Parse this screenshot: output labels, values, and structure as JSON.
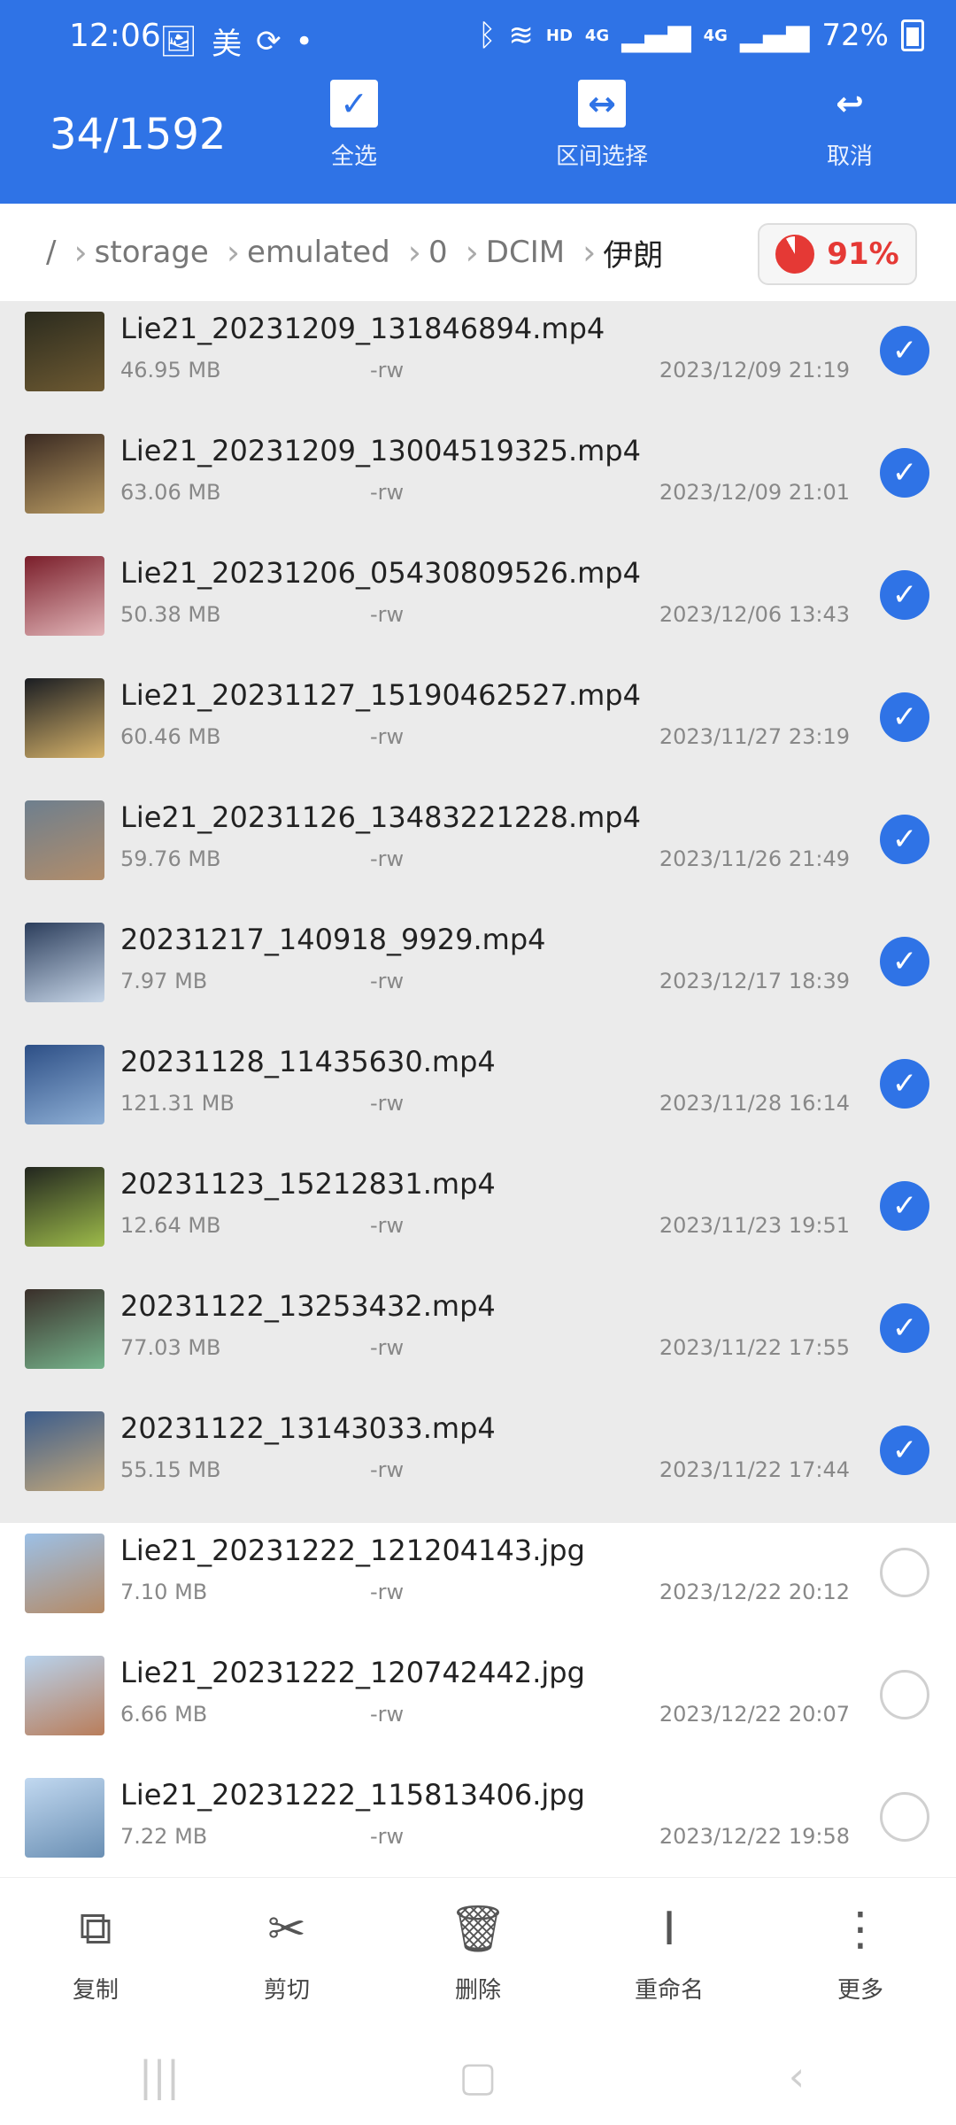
{
  "status": {
    "time": "12:06",
    "left_icons": [
      "image-icon",
      "美",
      "sync-icon",
      "dot-icon"
    ],
    "right_icons": [
      "bluetooth-icon",
      "wifi-icon",
      "signal-icon",
      "signal-icon"
    ],
    "hd": "HD",
    "net1": "4G",
    "net2": "4G",
    "battery": "72%"
  },
  "header": {
    "count": "34/1592",
    "actions": [
      {
        "label": "全选",
        "icon": "checkbox-icon",
        "glyph": "✓"
      },
      {
        "label": "区间选择",
        "icon": "range-select-icon",
        "glyph": "↔"
      },
      {
        "label": "取消",
        "icon": "undo-icon",
        "glyph": "↩"
      }
    ]
  },
  "breadcrumb": {
    "root": "/",
    "items": [
      "storage",
      "emulated",
      "0",
      "DCIM",
      "伊朗"
    ],
    "storage_percent": "91%"
  },
  "files": [
    {
      "name": "Lie21_20231209_131846894.mp4",
      "size": "46.95 MB",
      "perm": "-rw",
      "date": "2023/12/09 21:19",
      "selected": true,
      "thumb": [
        "#2b2b1e",
        "#6e5a32"
      ]
    },
    {
      "name": "Lie21_20231209_13004519325.mp4",
      "size": "63.06 MB",
      "perm": "-rw",
      "date": "2023/12/09 21:01",
      "selected": true,
      "thumb": [
        "#3a2a22",
        "#b89a62"
      ]
    },
    {
      "name": "Lie21_20231206_05430809526.mp4",
      "size": "50.38 MB",
      "perm": "-rw",
      "date": "2023/12/06 13:43",
      "selected": true,
      "thumb": [
        "#7a1e2a",
        "#e2b6b9"
      ]
    },
    {
      "name": "Lie21_20231127_15190462527.mp4",
      "size": "60.46 MB",
      "perm": "-rw",
      "date": "2023/11/27 23:19",
      "selected": true,
      "thumb": [
        "#1a1d22",
        "#d7b36a"
      ]
    },
    {
      "name": "Lie21_20231126_13483221228.mp4",
      "size": "59.76 MB",
      "perm": "-rw",
      "date": "2023/11/26 21:49",
      "selected": true,
      "thumb": [
        "#6e7f8e",
        "#b28d6a"
      ]
    },
    {
      "name": "20231217_140918_9929.mp4",
      "size": "7.97 MB",
      "perm": "-rw",
      "date": "2023/12/17 18:39",
      "selected": true,
      "thumb": [
        "#2c3e5c",
        "#c7d6e8"
      ]
    },
    {
      "name": "20231128_11435630.mp4",
      "size": "121.31 MB",
      "perm": "-rw",
      "date": "2023/11/28 16:14",
      "selected": true,
      "thumb": [
        "#2d4f86",
        "#8fb0d6"
      ]
    },
    {
      "name": "20231123_15212831.mp4",
      "size": "12.64 MB",
      "perm": "-rw",
      "date": "2023/11/23 19:51",
      "selected": true,
      "thumb": [
        "#22261f",
        "#9dbb4a"
      ]
    },
    {
      "name": "20231122_13253432.mp4",
      "size": "77.03 MB",
      "perm": "-rw",
      "date": "2023/11/22 17:55",
      "selected": true,
      "thumb": [
        "#3a2f2a",
        "#76b48c"
      ]
    },
    {
      "name": "20231122_13143033.mp4",
      "size": "55.15 MB",
      "perm": "-rw",
      "date": "2023/11/22 17:44",
      "selected": true,
      "thumb": [
        "#3c5d8c",
        "#c2a77a"
      ]
    },
    {
      "name": "Lie21_20231222_121204143.jpg",
      "size": "7.10 MB",
      "perm": "-rw",
      "date": "2023/12/22 20:12",
      "selected": false,
      "thumb": [
        "#9cc0e6",
        "#b58a65"
      ]
    },
    {
      "name": "Lie21_20231222_120742442.jpg",
      "size": "6.66 MB",
      "perm": "-rw",
      "date": "2023/12/22 20:07",
      "selected": false,
      "thumb": [
        "#b8d2ec",
        "#b97d5a"
      ]
    },
    {
      "name": "Lie21_20231222_115813406.jpg",
      "size": "7.22 MB",
      "perm": "-rw",
      "date": "2023/12/22 19:58",
      "selected": false,
      "thumb": [
        "#c1d8f0",
        "#6a8fb3"
      ]
    }
  ],
  "bottom_actions": [
    {
      "label": "复制",
      "icon": "copy-icon",
      "glyph": "⧉"
    },
    {
      "label": "剪切",
      "icon": "scissors-icon",
      "glyph": "✂"
    },
    {
      "label": "删除",
      "icon": "trash-icon",
      "glyph": "🗑"
    },
    {
      "label": "重命名",
      "icon": "text-cursor-icon",
      "glyph": "I"
    },
    {
      "label": "更多",
      "icon": "more-icon",
      "glyph": "⋮"
    }
  ],
  "nav": [
    {
      "icon": "recent-apps-icon",
      "glyph": "|||"
    },
    {
      "icon": "home-icon",
      "glyph": "▢"
    },
    {
      "icon": "back-icon",
      "glyph": "‹"
    }
  ],
  "colors": {
    "primary": "#2f73e6",
    "selected_row": "#ebebeb",
    "accent_red": "#e53935"
  }
}
